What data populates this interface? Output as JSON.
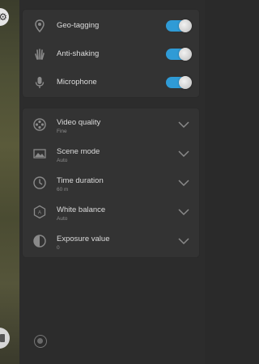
{
  "toggles": [
    {
      "label": "Geo-tagging",
      "icon": "location-pin-icon",
      "on": true
    },
    {
      "label": "Anti-shaking",
      "icon": "hand-icon",
      "on": true
    },
    {
      "label": "Microphone",
      "icon": "microphone-icon",
      "on": true
    }
  ],
  "settings": [
    {
      "label": "Video quality",
      "value": "Fine",
      "icon": "film-reel-icon"
    },
    {
      "label": "Scene mode",
      "value": "Auto",
      "icon": "landscape-icon"
    },
    {
      "label": "Time duration",
      "value": "60 m",
      "icon": "clock-icon"
    },
    {
      "label": "White balance",
      "value": "Auto",
      "icon": "white-balance-icon"
    },
    {
      "label": "Exposure value",
      "value": "0",
      "icon": "exposure-icon"
    }
  ],
  "colors": {
    "accent": "#2f9bd6",
    "panel": "#333333",
    "background": "#2c2c2c"
  }
}
